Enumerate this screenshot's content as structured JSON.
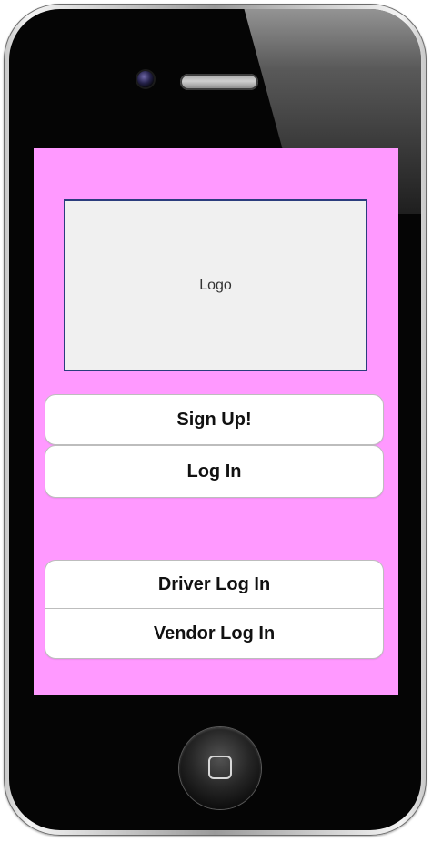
{
  "screen": {
    "logo_label": "Logo"
  },
  "buttons": {
    "sign_up": "Sign Up!",
    "log_in": "Log In",
    "driver_log_in": "Driver Log In",
    "vendor_log_in": "Vendor Log In"
  },
  "theme": {
    "screen_background": "#ff99ff",
    "logo_background": "#f0f0f0",
    "logo_border": "#2b3d7d",
    "button_background": "#ffffff",
    "button_text": "#111111"
  },
  "icons": {
    "device": "phone-icon",
    "home": "home-button-icon",
    "camera": "camera-icon",
    "speaker": "speaker-icon"
  }
}
